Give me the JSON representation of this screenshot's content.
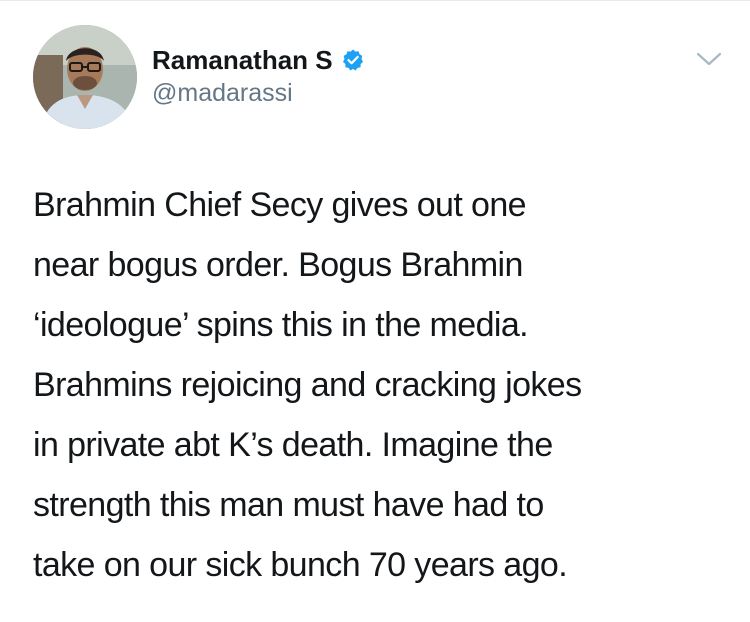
{
  "user": {
    "display_name": "Ramanathan S",
    "handle": "@madarassi",
    "verified": true
  },
  "icons": {
    "avatar": "profile-photo",
    "verified": "verified-check-icon",
    "menu": "chevron-down-icon"
  },
  "colors": {
    "verified_blue": "#1da1f2",
    "handle_gray": "#657786",
    "text": "#14171a",
    "caret_gray": "#aab8c2"
  },
  "tweet": {
    "lines": [
      "Brahmin Chief Secy gives out one",
      "near bogus order. Bogus Brahmin",
      "‘ideologue’ spins this in the media.",
      "Brahmins rejoicing and cracking jokes",
      "in private abt K’s death. Imagine the",
      "strength this man must have had to",
      "take on our sick bunch 70 years ago."
    ]
  }
}
